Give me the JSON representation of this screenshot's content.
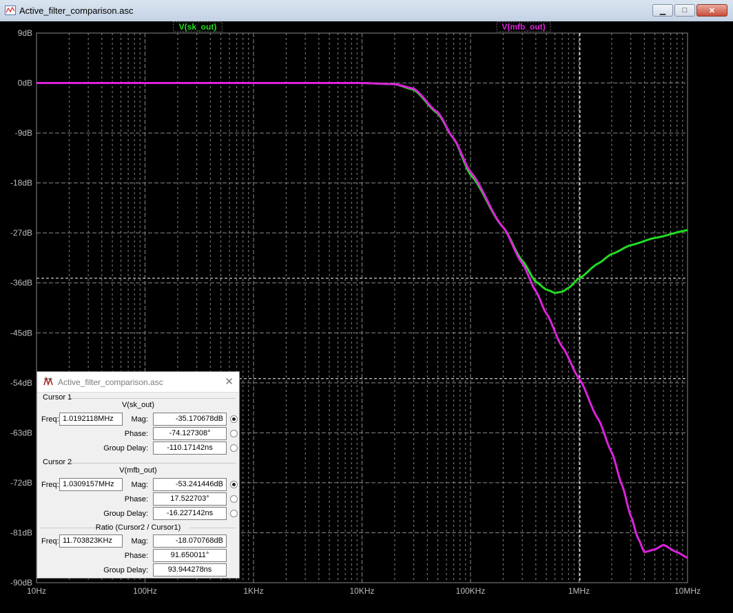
{
  "window": {
    "title": "Active_filter_comparison.asc",
    "buttons": {
      "minimize": "▁",
      "maximize": "□",
      "close": "✕"
    }
  },
  "plot": {
    "background": "#000000",
    "traces": [
      {
        "name": "V(sk_out)",
        "color": "#22dd22"
      },
      {
        "name": "V(mfb_out)",
        "color": "#dd22dd"
      }
    ],
    "y_ticks": [
      "9dB",
      "0dB",
      "-9dB",
      "-18dB",
      "-27dB",
      "-36dB",
      "-45dB",
      "-54dB",
      "-63dB",
      "-72dB",
      "-81dB",
      "-90dB"
    ],
    "x_ticks": [
      "10Hz",
      "100Hz",
      "1KHz",
      "10KHz",
      "100KHz",
      "1MHz",
      "10MHz"
    ]
  },
  "chart_data": {
    "type": "line",
    "x_scale": "log",
    "xlim_hz": [
      10,
      10000000
    ],
    "ylim_db": [
      -90,
      9
    ],
    "xlabel": "",
    "ylabel": "",
    "grid": true,
    "legend_placement": "top",
    "series": [
      {
        "name": "V(sk_out)",
        "x": [
          10,
          100,
          1000,
          10000,
          20000,
          30000,
          50000,
          70000,
          100000,
          200000,
          300000,
          400000,
          500000,
          600000,
          700000,
          800000,
          1000000,
          1500000,
          2000000,
          3000000,
          5000000,
          10000000
        ],
        "y": [
          0,
          0,
          0,
          0,
          -0.2,
          -1.2,
          -5.5,
          -10,
          -16.5,
          -26,
          -32,
          -35.8,
          -37.2,
          -37.8,
          -37.6,
          -36.9,
          -35.2,
          -32.5,
          -30.8,
          -29.2,
          -27.9,
          -26.5
        ]
      },
      {
        "name": "V(mfb_out)",
        "x": [
          10,
          100,
          1000,
          10000,
          20000,
          30000,
          50000,
          70000,
          100000,
          200000,
          300000,
          400000,
          500000,
          700000,
          1000000,
          1500000,
          2000000,
          2500000,
          3000000,
          3500000,
          4000000,
          5000000,
          6000000,
          8000000,
          10000000
        ],
        "y": [
          0,
          0,
          0,
          0,
          -0.2,
          -1.0,
          -5.3,
          -10,
          -16,
          -26,
          -32.5,
          -37.5,
          -41.5,
          -47.5,
          -53.2,
          -60.5,
          -66.5,
          -72.5,
          -78,
          -82,
          -84.5,
          -84,
          -83.2,
          -84.5,
          -85.5
        ]
      }
    ],
    "cursors": [
      {
        "freq_hz": 1019211.8,
        "db": -35.170678
      },
      {
        "freq_hz": 1030915.7,
        "db": -53.241446
      }
    ]
  },
  "dialog": {
    "title": "Active_filter_comparison.asc",
    "close": "✕",
    "cursor1": {
      "group_label": "Cursor 1",
      "trace": "V(sk_out)",
      "freq_label": "Freq:",
      "freq": "1.0192118MHz",
      "mag_label": "Mag:",
      "mag": "-35.170678dB",
      "phase_label": "Phase:",
      "phase": "-74.127308°",
      "gd_label": "Group Delay:",
      "gd": "-110.17142ns"
    },
    "cursor2": {
      "group_label": "Cursor 2",
      "trace": "V(mfb_out)",
      "freq_label": "Freq:",
      "freq": "1.0309157MHz",
      "mag_label": "Mag:",
      "mag": "-53.241446dB",
      "phase_label": "Phase:",
      "phase": "17.522703°",
      "gd_label": "Group Delay:",
      "gd": "-16.227142ns"
    },
    "ratio": {
      "group_label": "Ratio (Cursor2 / Cursor1)",
      "freq_label": "Freq:",
      "freq": "11.703823KHz",
      "mag_label": "Mag:",
      "mag": "-18.070768dB",
      "phase_label": "Phase:",
      "phase": "91.650011°",
      "gd_label": "Group Delay:",
      "gd": "93.944278ns"
    }
  }
}
